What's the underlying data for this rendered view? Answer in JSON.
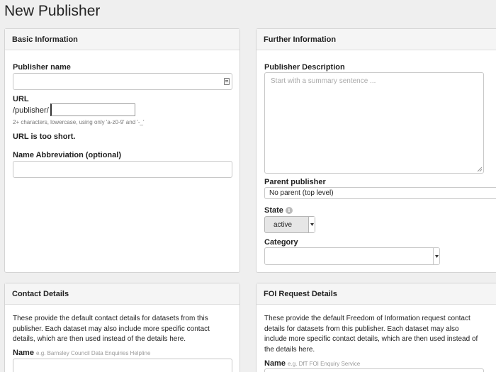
{
  "page": {
    "title": "New Publisher"
  },
  "basic": {
    "heading": "Basic Information",
    "publisher_name_label": "Publisher name",
    "publisher_name_value": "",
    "url_label": "URL",
    "url_prefix": "/publisher/",
    "url_value": "",
    "url_hint": "2+ characters, lowercase, using only 'a-z0-9' and '-_'",
    "url_error": "URL is too short.",
    "abbrev_label": "Name Abbreviation (optional)",
    "abbrev_value": ""
  },
  "further": {
    "heading": "Further Information",
    "description_label": "Publisher Description",
    "description_placeholder": "Start with a summary sentence ...",
    "parent_label": "Parent publisher",
    "parent_selected": "No parent (top level)",
    "state_label": "State",
    "state_selected": "active",
    "category_label": "Category",
    "category_selected": ""
  },
  "contact": {
    "heading": "Contact Details",
    "description": "These provide the default contact details for datasets from this publisher. Each dataset may also include more specific contact details, which are then used instead of the details here.",
    "name_label": "Name",
    "name_example": "e.g. Barnsley Council Data Enquiries Helpline"
  },
  "foi": {
    "heading": "FOI Request Details",
    "description": "These provide the default Freedom of Information request contact details for datasets from this publisher. Each dataset may also include more specific contact details, which are then used instead of the details here.",
    "name_label": "Name",
    "name_example": "e.g. DfT FOI Enquiry Service"
  },
  "icons": {
    "autofill": "contact-card-icon",
    "info": "info-icon",
    "dropdown": "chevron-down-icon",
    "resize": "resize-grip-icon"
  }
}
